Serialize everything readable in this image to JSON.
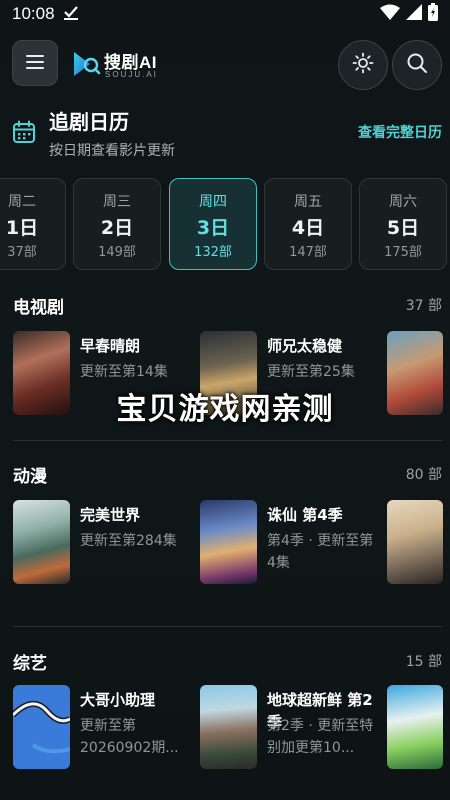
{
  "status": {
    "time": "10:08"
  },
  "app": {
    "name": "搜剧AI",
    "sub": "SOUJU.AI"
  },
  "calendar": {
    "title": "追剧日历",
    "subtitle": "按日期查看影片更新",
    "link": "查看完整日历",
    "days": [
      {
        "week": "周二",
        "date": "1日",
        "count": "37部"
      },
      {
        "week": "周三",
        "date": "2日",
        "count": "149部"
      },
      {
        "week": "周四",
        "date": "3日",
        "count": "132部",
        "active": true
      },
      {
        "week": "周五",
        "date": "4日",
        "count": "147部"
      },
      {
        "week": "周六",
        "date": "5日",
        "count": "175部"
      }
    ]
  },
  "sections": [
    {
      "title": "电视剧",
      "count": "37 部",
      "items": [
        {
          "title": "早春晴朗",
          "update": "更新至第14集"
        },
        {
          "title": "师兄太稳健",
          "update": "更新至第25集"
        }
      ]
    },
    {
      "title": "动漫",
      "count": "80 部",
      "items": [
        {
          "title": "完美世界",
          "update": "更新至第284集"
        },
        {
          "title": "诛仙 第4季",
          "update": "第4季 · 更新至第4集"
        }
      ]
    },
    {
      "title": "综艺",
      "count": "15 部",
      "items": [
        {
          "title": "大哥小助理",
          "update": "更新至第20260902期..."
        },
        {
          "title": "地球超新鲜 第2季",
          "update": "第2季 · 更新至特别加更第10..."
        }
      ]
    }
  ],
  "watermark": "宝贝游戏网亲测",
  "colors": {
    "accent": "#4fd3d5",
    "background": "#0f1517"
  }
}
